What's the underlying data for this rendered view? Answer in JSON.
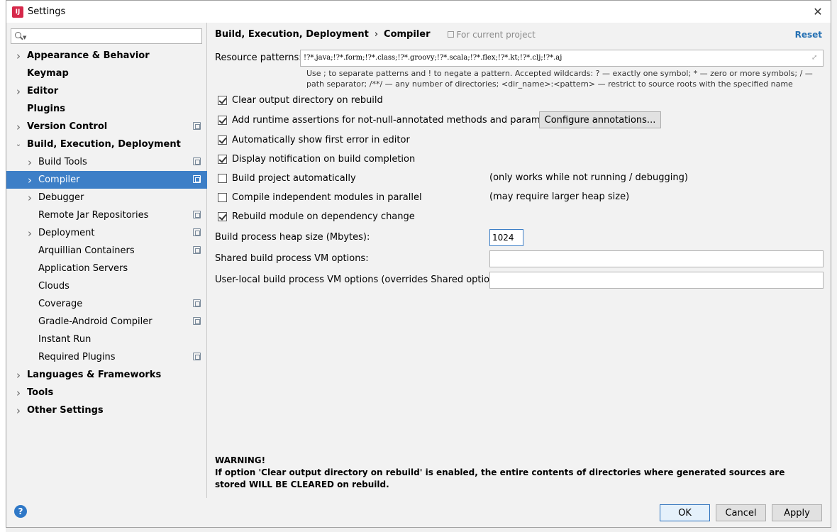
{
  "window": {
    "title": "Settings",
    "app_icon": "intellij-icon"
  },
  "search": {
    "placeholder": ""
  },
  "sidebar": {
    "items": [
      {
        "label": "Appearance & Behavior",
        "level": 0,
        "expand": "collapsed",
        "bold": true,
        "project": false,
        "selected": false
      },
      {
        "label": "Keymap",
        "level": 0,
        "expand": "none",
        "bold": true,
        "project": false,
        "selected": false
      },
      {
        "label": "Editor",
        "level": 0,
        "expand": "collapsed",
        "bold": true,
        "project": false,
        "selected": false
      },
      {
        "label": "Plugins",
        "level": 0,
        "expand": "none",
        "bold": true,
        "project": false,
        "selected": false
      },
      {
        "label": "Version Control",
        "level": 0,
        "expand": "collapsed",
        "bold": true,
        "project": true,
        "selected": false
      },
      {
        "label": "Build, Execution, Deployment",
        "level": 0,
        "expand": "expanded",
        "bold": true,
        "project": false,
        "selected": false
      },
      {
        "label": "Build Tools",
        "level": 1,
        "expand": "collapsed",
        "bold": false,
        "project": true,
        "selected": false
      },
      {
        "label": "Compiler",
        "level": 1,
        "expand": "collapsed",
        "bold": false,
        "project": true,
        "selected": true
      },
      {
        "label": "Debugger",
        "level": 1,
        "expand": "collapsed",
        "bold": false,
        "project": false,
        "selected": false
      },
      {
        "label": "Remote Jar Repositories",
        "level": 1,
        "expand": "none",
        "bold": false,
        "project": true,
        "selected": false
      },
      {
        "label": "Deployment",
        "level": 1,
        "expand": "collapsed",
        "bold": false,
        "project": true,
        "selected": false
      },
      {
        "label": "Arquillian Containers",
        "level": 1,
        "expand": "none",
        "bold": false,
        "project": true,
        "selected": false
      },
      {
        "label": "Application Servers",
        "level": 1,
        "expand": "none",
        "bold": false,
        "project": false,
        "selected": false
      },
      {
        "label": "Clouds",
        "level": 1,
        "expand": "none",
        "bold": false,
        "project": false,
        "selected": false
      },
      {
        "label": "Coverage",
        "level": 1,
        "expand": "none",
        "bold": false,
        "project": true,
        "selected": false
      },
      {
        "label": "Gradle-Android Compiler",
        "level": 1,
        "expand": "none",
        "bold": false,
        "project": true,
        "selected": false
      },
      {
        "label": "Instant Run",
        "level": 1,
        "expand": "none",
        "bold": false,
        "project": false,
        "selected": false
      },
      {
        "label": "Required Plugins",
        "level": 1,
        "expand": "none",
        "bold": false,
        "project": true,
        "selected": false
      },
      {
        "label": "Languages & Frameworks",
        "level": 0,
        "expand": "collapsed",
        "bold": true,
        "project": false,
        "selected": false
      },
      {
        "label": "Tools",
        "level": 0,
        "expand": "collapsed",
        "bold": true,
        "project": false,
        "selected": false
      },
      {
        "label": "Other Settings",
        "level": 0,
        "expand": "collapsed",
        "bold": true,
        "project": false,
        "selected": false
      }
    ]
  },
  "header": {
    "crumb_parent": "Build, Execution, Deployment",
    "crumb_sep": "›",
    "crumb_current": "Compiler",
    "scope": "For current project",
    "reset": "Reset"
  },
  "resource": {
    "label": "Resource patterns:",
    "value": "!?*.java;!?*.form;!?*.class;!?*.groovy;!?*.scala;!?*.flex;!?*.kt;!?*.clj;!?*.aj",
    "hint": "Use ; to separate patterns and ! to negate a pattern. Accepted wildcards: ? — exactly one symbol; * — zero or more symbols; / — path separator; /**/ — any number of directories; <dir_name>:<pattern> — restrict to source roots with the specified name"
  },
  "options": [
    {
      "label": "Clear output directory on rebuild",
      "checked": true,
      "note": ""
    },
    {
      "label": "Add runtime assertions for not-null-annotated methods and parameters",
      "checked": true,
      "note": ""
    },
    {
      "label": "Automatically show first error in editor",
      "checked": true,
      "note": ""
    },
    {
      "label": "Display notification on build completion",
      "checked": true,
      "note": ""
    },
    {
      "label": "Build project automatically",
      "checked": false,
      "note": "(only works while not running / debugging)"
    },
    {
      "label": "Compile independent modules in parallel",
      "checked": false,
      "note": "(may require larger heap size)"
    },
    {
      "label": "Rebuild module on dependency change",
      "checked": true,
      "note": ""
    }
  ],
  "configure_button": "Configure annotations...",
  "heap": {
    "label": "Build process heap size (Mbytes):",
    "value": "1024"
  },
  "shared_vm": {
    "label": "Shared build process VM options:",
    "value": ""
  },
  "user_vm": {
    "label": "User-local build process VM options (overrides Shared options):",
    "value": ""
  },
  "warning": {
    "title": "WARNING!",
    "text": "If option 'Clear output directory on rebuild' is enabled, the entire contents of directories where generated sources are stored WILL BE CLEARED on rebuild."
  },
  "footer": {
    "ok": "OK",
    "cancel": "Cancel",
    "apply": "Apply",
    "help": "?"
  },
  "colors": {
    "selection": "#3d7fc7",
    "link": "#2470b3",
    "help": "#2f78c7"
  }
}
